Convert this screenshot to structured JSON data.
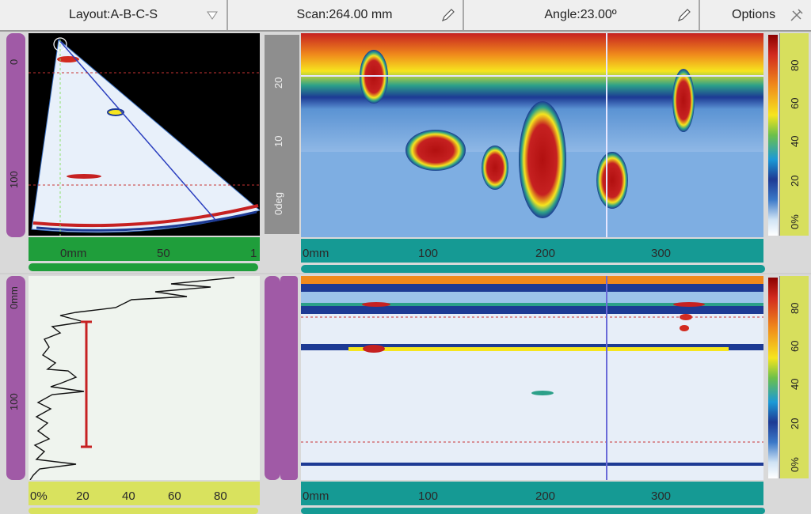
{
  "toolbar": {
    "layout_label": "Layout:A-B-C-S",
    "scan_label": "Scan:264.00 mm",
    "angle_label": "Angle:23.00º",
    "options_label": "Options"
  },
  "sscan": {
    "x_ticks": [
      "0mm",
      "50",
      "1"
    ],
    "y_ticks": [
      "0",
      "100"
    ]
  },
  "cscan_top": {
    "x_ticks": [
      "0mm",
      "100",
      "200",
      "300"
    ],
    "y_ticks": [
      "20",
      "10",
      "0deg"
    ],
    "colorbar_ticks": [
      "80",
      "60",
      "40",
      "20",
      "0%"
    ]
  },
  "ascan": {
    "x_ticks": [
      "0%",
      "20",
      "40",
      "60",
      "80"
    ],
    "y_ticks": [
      "0mm",
      "100"
    ]
  },
  "cscan_bottom": {
    "x_ticks": [
      "0mm",
      "100",
      "200",
      "300"
    ],
    "colorbar_ticks": [
      "80",
      "60",
      "40",
      "20",
      "0%"
    ]
  }
}
